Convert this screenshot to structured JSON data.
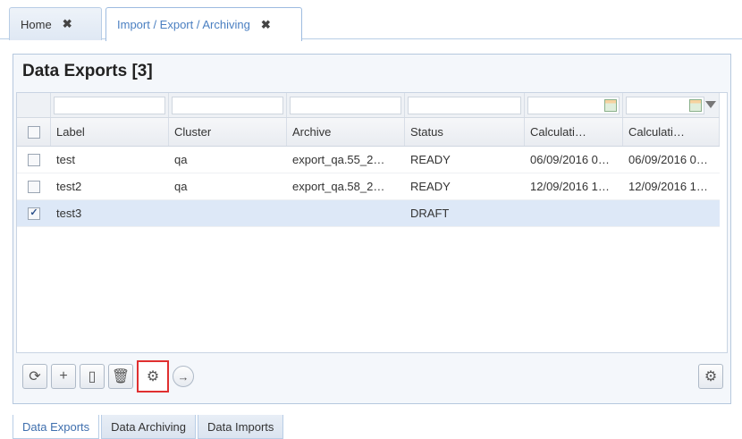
{
  "tabs": [
    {
      "label": "Home",
      "close": "✖"
    },
    {
      "label": "Import / Export / Archiving",
      "close": "✖"
    }
  ],
  "panel": {
    "title": "Data Exports [3]"
  },
  "grid": {
    "columns": [
      "Label",
      "Cluster",
      "Archive",
      "Status",
      "Calculati…",
      "Calculati…"
    ],
    "rows": [
      {
        "checked": false,
        "check": "",
        "label": "test",
        "cluster": "qa",
        "archive": "export_qa.55_2…",
        "status": "READY",
        "calc1": "06/09/2016 0…",
        "calc2": "06/09/2016 0…"
      },
      {
        "checked": false,
        "check": "",
        "label": "test2",
        "cluster": "qa",
        "archive": "export_qa.58_2…",
        "status": "READY",
        "calc1": "12/09/2016 1…",
        "calc2": "12/09/2016 1…"
      },
      {
        "checked": true,
        "check": "✓",
        "label": "test3",
        "cluster": "",
        "archive": "",
        "status": "DRAFT",
        "calc1": "",
        "calc2": ""
      }
    ]
  },
  "toolbar": {
    "icons": [
      "refresh-icon",
      "add-document-icon",
      "document-icon",
      "trash-icon",
      "gear-icon",
      "arrow-right-circle-icon"
    ],
    "refresh": "⟳",
    "add": "+",
    "doc": "▯",
    "trash": "🗑",
    "gear": "⚙",
    "go": "→",
    "settings": "⚙"
  },
  "bottom_tabs": [
    "Data Exports",
    "Data Archiving",
    "Data Imports"
  ],
  "colors": {
    "accent": "#4a7fc1",
    "selected_row": "#dde8f7",
    "highlight_border": "#e03030"
  }
}
